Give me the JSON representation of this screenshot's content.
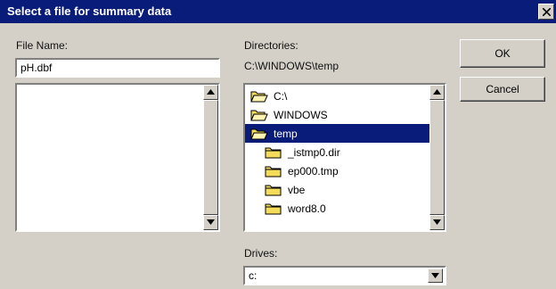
{
  "dialog": {
    "title": "Select a file for summary data",
    "file_name_label": "File Name:",
    "file_name_value": "pH.dbf",
    "directories_label": "Directories:",
    "current_path": "C:\\WINDOWS\\temp",
    "directories": [
      {
        "name": "C:\\",
        "open": true,
        "selected": false
      },
      {
        "name": "WINDOWS",
        "open": true,
        "selected": false
      },
      {
        "name": "temp",
        "open": true,
        "selected": true
      },
      {
        "name": "_istmp0.dir",
        "open": false,
        "selected": false
      },
      {
        "name": "ep000.tmp",
        "open": false,
        "selected": false
      },
      {
        "name": "vbe",
        "open": false,
        "selected": false
      },
      {
        "name": "word8.0",
        "open": false,
        "selected": false
      }
    ],
    "drives_label": "Drives:",
    "drive_value": "c:",
    "ok_label": "OK",
    "cancel_label": "Cancel"
  },
  "colors": {
    "titlebar": "#0a1c7a",
    "face": "#d4d0c8",
    "selection": "#0a1c7a",
    "folder": "#f4dc5a"
  }
}
